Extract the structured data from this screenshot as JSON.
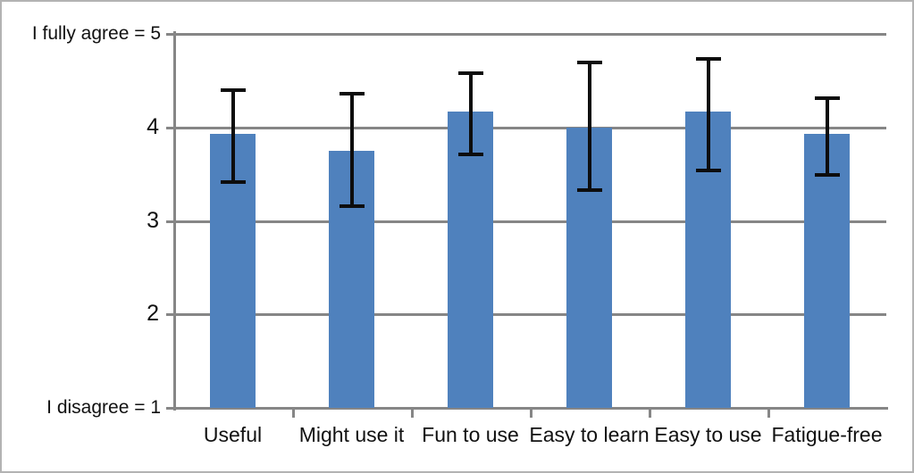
{
  "chart_data": {
    "type": "bar",
    "title": "",
    "xlabel": "",
    "ylabel": "",
    "ylim": [
      1,
      5
    ],
    "grid": true,
    "legend": false,
    "orientation": "vertical",
    "bar_color": "#4F81BD",
    "error_bar_color": "#0D0D0D",
    "grid_color": "#868686",
    "categories": [
      "Useful",
      "Might use it",
      "Fun to use",
      "Easy to learn",
      "Easy to use",
      "Fatigue-free"
    ],
    "values": [
      3.93,
      3.75,
      4.17,
      4.0,
      4.17,
      3.93
    ],
    "error_low": [
      3.4,
      3.14,
      3.69,
      3.31,
      3.52,
      3.47
    ],
    "error_high": [
      4.42,
      4.38,
      4.6,
      4.71,
      4.75,
      4.33
    ],
    "yticks": [
      1,
      2,
      3,
      4,
      5
    ],
    "ytick_labels": [
      "1",
      "2",
      "3",
      "4",
      "5"
    ],
    "y_axis_end_labels": {
      "top": "I fully agree = 5",
      "bottom": "I disagree = 1"
    }
  },
  "axis": {
    "y_visible_ticks": [
      "2",
      "3",
      "4"
    ],
    "top_label": "I fully agree = 5",
    "bottom_label": "I disagree = 1"
  }
}
